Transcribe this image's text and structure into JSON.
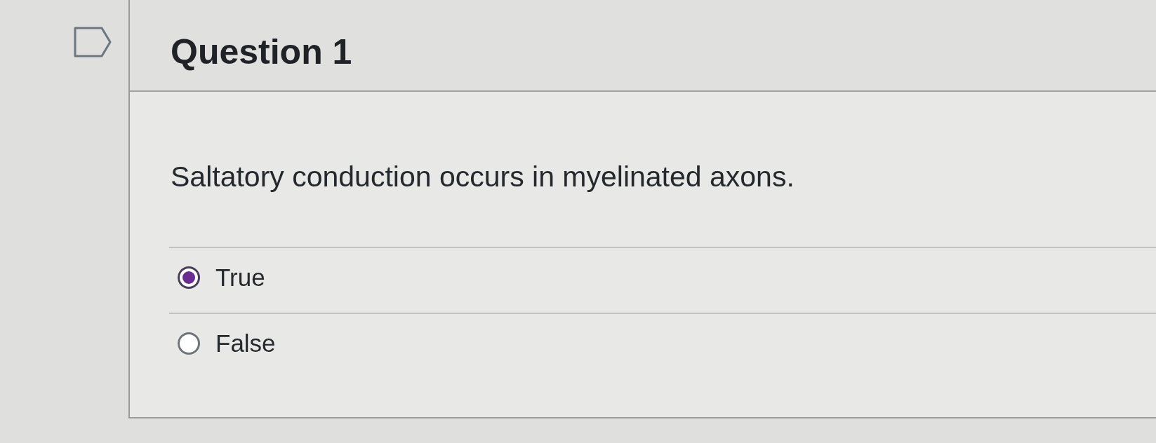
{
  "question": {
    "title": "Question 1",
    "flagged": false,
    "text": "Saltatory conduction occurs in myelinated axons.",
    "answers": [
      {
        "label": "True",
        "selected": true
      },
      {
        "label": "False",
        "selected": false
      }
    ]
  }
}
